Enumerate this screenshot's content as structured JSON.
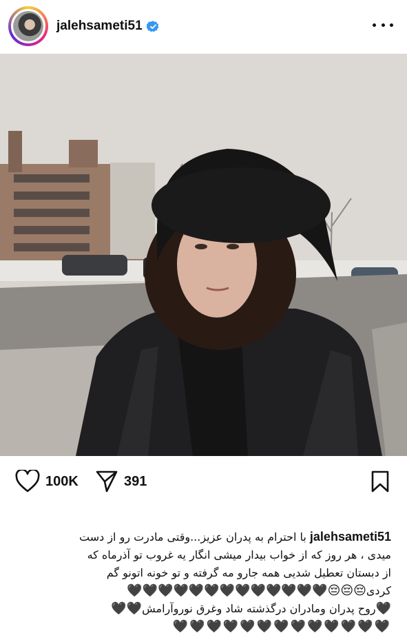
{
  "post": {
    "username": "jalehsameti51",
    "verified": true,
    "more_icon": "more-horizontal-icon"
  },
  "stats": {
    "likes": "100K",
    "shares": "391"
  },
  "caption": {
    "username": "jalehsameti51",
    "line1": "با احترام به پدران عزیز...وقتی مادرت رو از دست",
    "line2": "میدی ، هر روز که از خواب بیدار میشی انگار یه غروب تو آذرماه که",
    "line3": "از دبستان تعطیل شدیی  همه جارو مه گرفته و تو خونه اتونو گم",
    "line4_text": "کردی",
    "line4_emoji": "😔😔😔🖤🖤🖤🖤🖤🖤🖤🖤🖤🖤🖤🖤🖤",
    "line5_text": "روح پدران ومادران درگذشته شاد وغرق نورو‌آرامش",
    "line5_emoji_start": "🖤",
    "line5_emoji_end": "🖤🖤",
    "line6_emoji": "🖤🖤🖤🖤🖤🖤🖤🖤🖤🖤🖤🖤🖤"
  },
  "colors": {
    "verified_blue": "#3797f0",
    "text": "#111111"
  }
}
